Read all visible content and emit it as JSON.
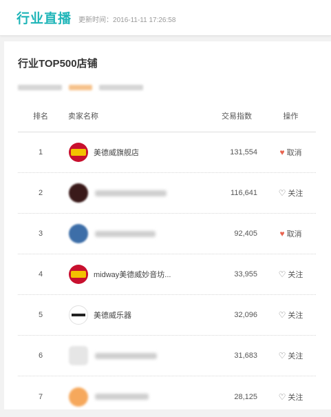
{
  "header": {
    "title": "行业直播",
    "update_time": "更新时间：2016-11-11 17:26:58"
  },
  "card": {
    "title": "行业TOP500店铺"
  },
  "table": {
    "headers": {
      "rank": "排名",
      "seller": "卖家名称",
      "index": "交易指数",
      "action": "操作"
    },
    "rows": [
      {
        "rank": "1",
        "name": "美德威旗舰店",
        "index": "131,554",
        "action": "取消",
        "followed": true
      },
      {
        "rank": "2",
        "name": "",
        "index": "116,641",
        "action": "关注",
        "followed": false
      },
      {
        "rank": "3",
        "name": "",
        "index": "92,405",
        "action": "取消",
        "followed": true
      },
      {
        "rank": "4",
        "name": "midway美德威妙音坊...",
        "index": "33,955",
        "action": "关注",
        "followed": false
      },
      {
        "rank": "5",
        "name": "美德威乐器",
        "index": "32,096",
        "action": "关注",
        "followed": false
      },
      {
        "rank": "6",
        "name": "",
        "index": "31,683",
        "action": "关注",
        "followed": false
      },
      {
        "rank": "7",
        "name": "",
        "index": "28,125",
        "action": "关注",
        "followed": false
      }
    ]
  },
  "icons": {
    "filled_heart": "heart-filled-icon",
    "outline_heart": "heart-outline-icon"
  },
  "colors": {
    "accent": "#1fb5b8",
    "heart": "#e8634f"
  }
}
